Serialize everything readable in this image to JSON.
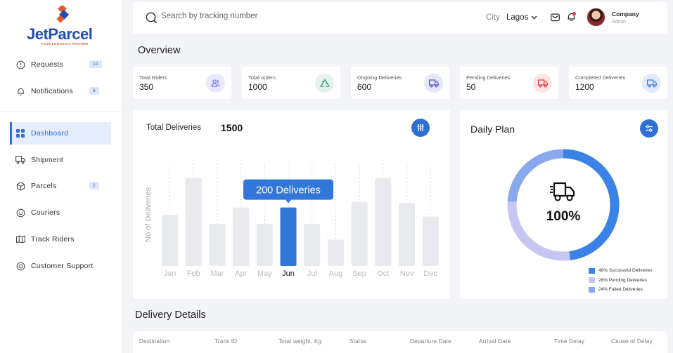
{
  "brand": {
    "name_part1": "Jet",
    "name_part2": "Parcel",
    "tagline": "YOUR LOGISTICS PARTNER",
    "colors": {
      "primary": "#1f4fb3",
      "accent": "#e25b2b"
    }
  },
  "sidebar": {
    "items": [
      {
        "label": "Requests",
        "icon": "alert-circle-icon",
        "badge": "10"
      },
      {
        "label": "Notifications",
        "icon": "bell-icon",
        "badge": "6"
      },
      {
        "label": "Dashboard",
        "icon": "grid-icon",
        "active": true
      },
      {
        "label": "Shipment",
        "icon": "truck-icon"
      },
      {
        "label": "Parcels",
        "icon": "box-icon",
        "badge": "2"
      },
      {
        "label": "Couriers",
        "icon": "courier-icon"
      },
      {
        "label": "Track Riders",
        "icon": "map-icon"
      },
      {
        "label": "Customer Support",
        "icon": "support-icon"
      }
    ]
  },
  "topbar": {
    "search_placeholder": "Search by tracking number",
    "city_label": "City",
    "city_value": "Lagos",
    "user_name": "Company",
    "user_role": "Admin"
  },
  "overview": {
    "title": "Overview",
    "stats": [
      {
        "label": "Total Riders",
        "value": "350",
        "icon": "riders-icon",
        "color": "#6b6ee8",
        "bg": "#e8e9fb"
      },
      {
        "label": "Total orders",
        "value": "1000",
        "icon": "recycle-icon",
        "color": "#2e9b63",
        "bg": "#e3f2ea"
      },
      {
        "label": "Ongoing Deliveries",
        "value": "600",
        "icon": "truck-icon",
        "color": "#4a4fc7",
        "bg": "#e6e7f5"
      },
      {
        "label": "Pending Deliveries",
        "value": "50",
        "icon": "truck-icon",
        "color": "#d93c3c",
        "bg": "#fbe3e3"
      },
      {
        "label": "Completed Deliveries",
        "value": "1200",
        "icon": "truck-icon",
        "color": "#3e78d8",
        "bg": "#e1eafb"
      }
    ]
  },
  "deliveries": {
    "title": "Total Deliveries",
    "total": "1500",
    "tooltip": "200 Deliveries"
  },
  "chart_data": {
    "type": "bar",
    "categories": [
      "Jan",
      "Feb",
      "Mar",
      "Apr",
      "May",
      "Jun",
      "Jul",
      "Aug",
      "Sep",
      "Oct",
      "Nov",
      "Dec"
    ],
    "values": [
      140,
      240,
      115,
      160,
      115,
      160,
      115,
      72,
      175,
      240,
      172,
      135
    ],
    "highlight_index": 5,
    "xlabel": "",
    "ylabel": "No of Deliveries",
    "ylim": [
      0,
      280
    ],
    "grid": "vertical dashed",
    "colors": {
      "bar": "#e9eaee",
      "highlight": "#3176d8",
      "tooltip": "#3176d8"
    }
  },
  "daily_plan": {
    "title": "Daily Plan",
    "percent_label": "100%",
    "segments": [
      {
        "label": "48% Successful Deliveries",
        "value": 48,
        "color": "#3b82e6"
      },
      {
        "label": "28% Pending Deliveries",
        "value": 28,
        "color": "#c7c6f2"
      },
      {
        "label": "24% Failed Deliveries",
        "value": 24,
        "color": "#8aa8ee"
      }
    ]
  },
  "details": {
    "title": "Delivery Details",
    "columns": [
      "Destination",
      "Track ID",
      "Total weight, Kg",
      "Status",
      "Departure Date",
      "Arrival Date",
      "Time Delay",
      "Cause of Delay"
    ]
  }
}
